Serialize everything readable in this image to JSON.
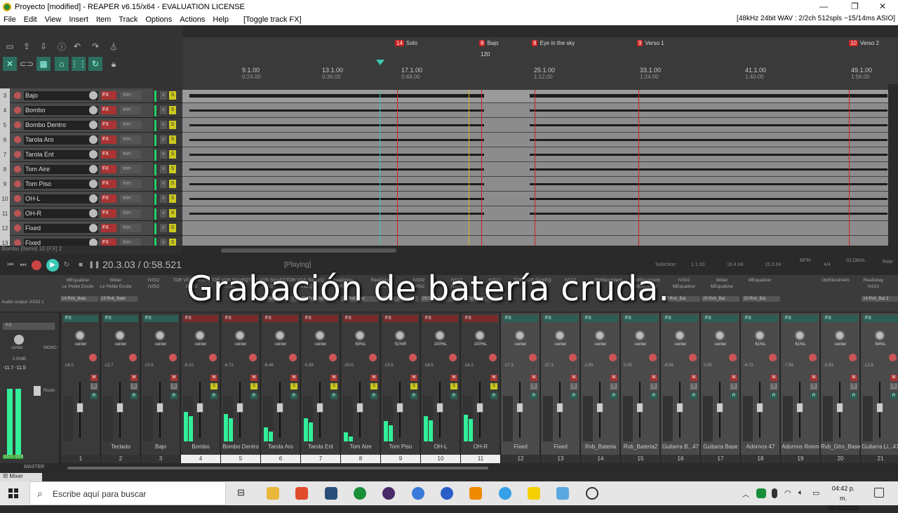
{
  "window": {
    "title": "Proyecto [modified] - REAPER v6.15/x64 - EVALUATION LICENSE",
    "controls": [
      "—",
      "❐",
      "✕"
    ]
  },
  "menu": {
    "items": [
      "File",
      "Edit",
      "View",
      "Insert",
      "Item",
      "Track",
      "Options",
      "Actions",
      "Help",
      "[Toggle track FX]"
    ],
    "status": "[48kHz 24bit WAV : 2/2ch 512spls ~15/14ms ASIO]"
  },
  "markers": [
    {
      "num": "14",
      "label": "Solo"
    },
    {
      "num": "8",
      "label": "Bajo"
    },
    {
      "num": "8",
      "label": "Eye in the sky"
    },
    {
      "num": "9",
      "label": "Verso 1"
    },
    {
      "num": "10",
      "label": "Verso 2"
    }
  ],
  "tempo_marker": "120",
  "ruler_ticks": [
    {
      "bar": "9.1.00",
      "time": "0:24.00"
    },
    {
      "bar": "13.1.00",
      "time": "0:36.00"
    },
    {
      "bar": "17.1.00",
      "time": "0:48.00"
    },
    {
      "bar": "25.1.00",
      "time": "1:12.00"
    },
    {
      "bar": "33.1.00",
      "time": "1:24.00"
    },
    {
      "bar": "41.1.00",
      "time": "1:40.00"
    },
    {
      "bar": "49.1.00",
      "time": "1:56.00"
    }
  ],
  "tracks": [
    {
      "num": "3",
      "name": "Bajo"
    },
    {
      "num": "4",
      "name": "Bombo"
    },
    {
      "num": "5",
      "name": "Bombo Dentro"
    },
    {
      "num": "6",
      "name": "Tarola Aro"
    },
    {
      "num": "7",
      "name": "Tarola Ent"
    },
    {
      "num": "8",
      "name": "Tom Aire"
    },
    {
      "num": "9",
      "name": "Tom Piso"
    },
    {
      "num": "10",
      "name": "OH-L"
    },
    {
      "num": "11",
      "name": "OH-R"
    },
    {
      "num": "12",
      "name": "Fixed"
    },
    {
      "num": "13",
      "name": "Fixed"
    }
  ],
  "track_labels": {
    "fx": "FX",
    "trim": "trim",
    "solo": "S"
  },
  "status_line": "Bombo [Items] 10 [FX] 2",
  "transport": {
    "time": "20.3.03 / 0:58.521",
    "state": "[Playing]",
    "selection_label": "Selection:",
    "sel_start": "1.1.00",
    "sel_end": "16.4.04",
    "sel_len": "15.3.04",
    "bpm_label": "BPM",
    "timesig": "4/4",
    "global": "GLOBAL",
    "rate": "Rate"
  },
  "fx_slots": [
    {
      "a": "MEqualizer",
      "b": "Le Petite Excite"
    },
    {
      "a": "Wider",
      "b": "Le Petite Excite"
    },
    {
      "a": "IVGI2",
      "b": "IVGI2"
    },
    {
      "a": "TDR VOS SlickEQ",
      "b": "IVGI2"
    },
    {
      "a": "TDR VOS SlickEQ",
      "b": "IVGI2"
    },
    {
      "a": "TDR VOS SlickEQ",
      "b": "IVGI2"
    },
    {
      "a": "TDR VOS SlickEQ",
      "b": "ReaEQ"
    },
    {
      "a": "ReaDelay",
      "b": "IVGI2"
    },
    {
      "a": "ReaDelay",
      "b": "IVGI2"
    },
    {
      "a": "IVGI2",
      "b": "IVGI2"
    },
    {
      "a": "IVGI2",
      "b": "IVGI2"
    },
    {
      "a": "IVGI2",
      "b": ""
    },
    {
      "a": "TDR VOS SlickEQ",
      "b": ""
    },
    {
      "a": "IVGI2",
      "b": ""
    },
    {
      "a": "OldSkoolVerb",
      "b": ""
    },
    {
      "a": "OldSkoolVerb",
      "b": "MEqualizer"
    },
    {
      "a": "IVGI2",
      "b": "MEqualizer"
    },
    {
      "a": "Wider",
      "b": "MEqualizer"
    },
    {
      "a": "MEqualizer",
      "b": ""
    },
    {
      "a": "",
      "b": ""
    },
    {
      "a": "OldSkoolVerb",
      "b": ""
    },
    {
      "a": "ReaDelay",
      "b": "IVGI2"
    }
  ],
  "sends": [
    "14:Rvb_Bate",
    "15:Rvb_Bate",
    "20:Rvb_Bat",
    "20:Rvb_Bat",
    "24:Rvb_Bat",
    "25:Rvb_Bate",
    "25:Rvb_Bate",
    "20:Rvb_Bat",
    "20:Rvb_Bat",
    "20:Rvb_Bat",
    "20:Rvb_Bat",
    "24:Rvb_Bat 3"
  ],
  "audio_output": "Audio output: ASIO 1",
  "caption": "Grabación de batería cruda.",
  "master": {
    "label": "MASTER",
    "pan": "center",
    "db": "0.00dB",
    "peaks": "-11.7 -11.5",
    "mono": "MONO",
    "fx": "FX",
    "route": "Route",
    "bottom": "-15.5 -13.6"
  },
  "mixer_strips": [
    {
      "num": "1",
      "name": "",
      "pan": "center",
      "db": "-16.0",
      "fx_red": false,
      "meter": 0,
      "sel": false
    },
    {
      "num": "2",
      "name": "Teclado",
      "pan": "center",
      "db": "-12.7",
      "fx_red": false,
      "meter": 0,
      "sel": false
    },
    {
      "num": "3",
      "name": "Bajo",
      "pan": "center",
      "db": "-10.5",
      "fx_red": false,
      "meter": 0,
      "sel": false
    },
    {
      "num": "4",
      "name": "Bombo",
      "pan": "center",
      "db": "-9.10",
      "fx_red": true,
      "meter": 0.65,
      "sel": true
    },
    {
      "num": "5",
      "name": "Bombo Dentro",
      "pan": "center",
      "db": "-6.72",
      "fx_red": true,
      "meter": 0.6,
      "sel": true
    },
    {
      "num": "6",
      "name": "Tarola Aro",
      "pan": "center",
      "db": "-8.46",
      "fx_red": true,
      "meter": 0.3,
      "sel": true
    },
    {
      "num": "7",
      "name": "Tarola Ent",
      "pan": "center",
      "db": "-5.99",
      "fx_red": true,
      "meter": 0.5,
      "sel": true
    },
    {
      "num": "8",
      "name": "Tom Aire",
      "pan": "63%L",
      "db": "-20.0",
      "fx_red": true,
      "meter": 0.2,
      "sel": true
    },
    {
      "num": "9",
      "name": "Tom Piso",
      "pan": "51%R",
      "db": "-15.5",
      "fx_red": true,
      "meter": 0.45,
      "sel": true
    },
    {
      "num": "10",
      "name": "OH-L",
      "pan": "100%L",
      "db": "-16.5",
      "fx_red": true,
      "meter": 0.55,
      "sel": true
    },
    {
      "num": "11",
      "name": "OH-R",
      "pan": "100%L",
      "db": "-16.2",
      "fx_red": true,
      "meter": 0.58,
      "sel": true
    },
    {
      "num": "12",
      "name": "Fixed",
      "pan": "center",
      "db": "-17.3",
      "fx_red": false,
      "meter": 0,
      "sel": false
    },
    {
      "num": "13",
      "name": "Fixed",
      "pan": "center",
      "db": "-37.3",
      "fx_red": false,
      "meter": 0,
      "sel": false
    },
    {
      "num": "14",
      "name": "Rvb_Bateria",
      "pan": "center",
      "db": "-2.65",
      "fx_red": false,
      "meter": 0,
      "sel": false
    },
    {
      "num": "15",
      "name": "Rvb_Bateria2",
      "pan": "center",
      "db": "0.00",
      "fx_red": false,
      "meter": 0,
      "sel": false
    },
    {
      "num": "16",
      "name": "Guitarra B...47",
      "pan": "center",
      "db": "-8.56",
      "fx_red": false,
      "meter": 0,
      "sel": false
    },
    {
      "num": "17",
      "name": "Guitarra Base",
      "pan": "center",
      "db": "0.00",
      "fx_red": false,
      "meter": 0,
      "sel": false
    },
    {
      "num": "18",
      "name": "Adornos 47",
      "pan": "61%L",
      "db": "-6.72",
      "fx_red": false,
      "meter": 0,
      "sel": false
    },
    {
      "num": "19",
      "name": "Adornos Room",
      "pan": "61%L",
      "db": "-7.58",
      "fx_red": false,
      "meter": 0,
      "sel": false
    },
    {
      "num": "20",
      "name": "Rvb_Gtrs_Base",
      "pan": "center",
      "db": "-5.93",
      "fx_red": false,
      "meter": 0,
      "sel": false
    },
    {
      "num": "21",
      "name": "Guitarra Li...47",
      "pan": "64%L",
      "db": "-12.9",
      "fx_red": false,
      "meter": 0,
      "sel": false
    }
  ],
  "mixer_tab": "Mixer",
  "taskbar": {
    "search_placeholder": "Escribe aquí para buscar",
    "time": "04:42 p. m.",
    "date": "08/02/2021"
  },
  "colors": {
    "accent": "#3cc8b4",
    "record": "#cc4444",
    "solo": "#ccc820",
    "meter": "#33ee99"
  }
}
